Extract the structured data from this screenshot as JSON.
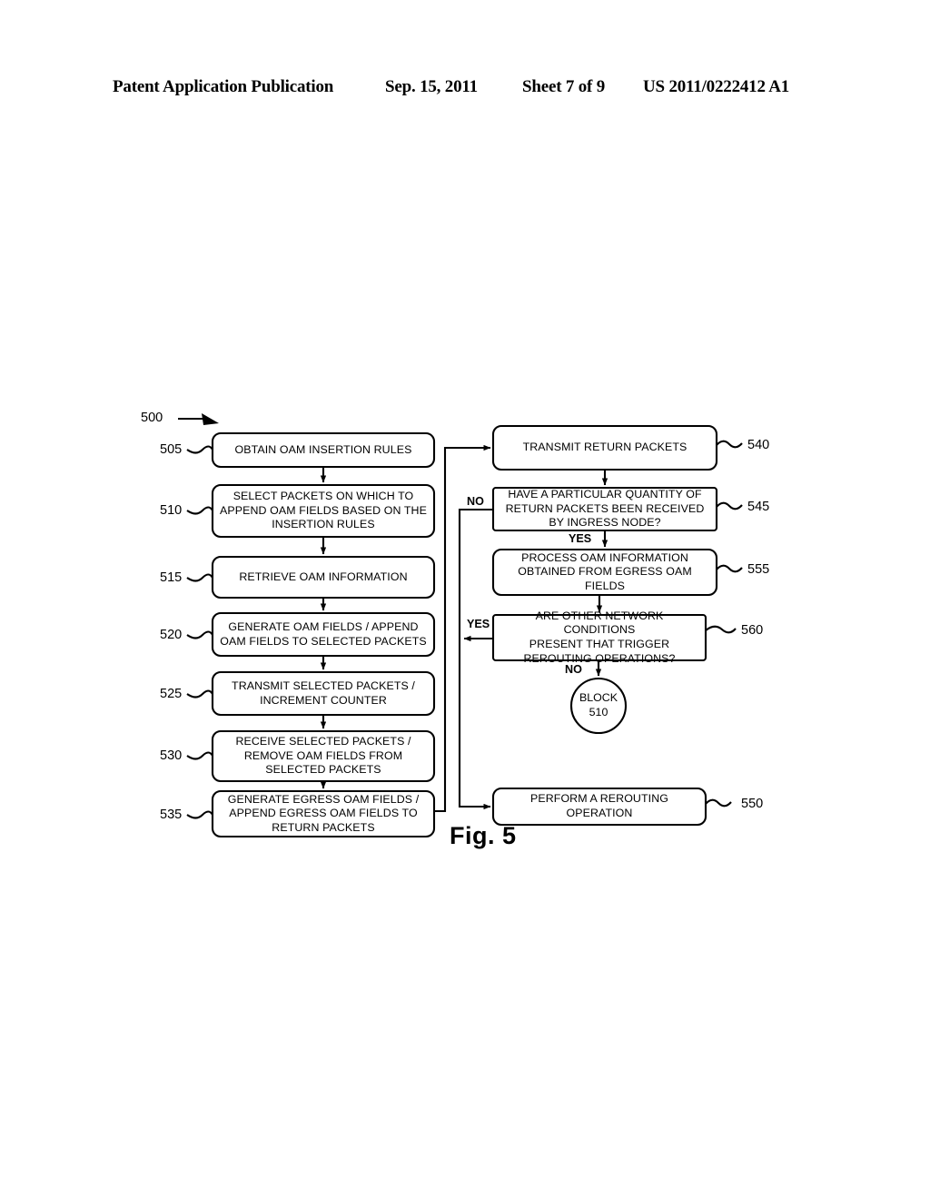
{
  "header": {
    "publication": "Patent Application Publication",
    "date": "Sep. 15, 2011",
    "sheet": "Sheet 7 of 9",
    "patent_number": "US 2011/0222412 A1"
  },
  "figure": {
    "caption": "Fig. 5",
    "diagram_ref": "500"
  },
  "nodes": [
    {
      "ref": "505",
      "text": "OBTAIN OAM INSERTION RULES"
    },
    {
      "ref": "510",
      "text": "SELECT PACKETS ON WHICH TO\nAPPEND OAM FIELDS BASED ON THE\nINSERTION RULES"
    },
    {
      "ref": "515",
      "text": "RETRIEVE OAM INFORMATION"
    },
    {
      "ref": "520",
      "text": "GENERATE OAM FIELDS / APPEND\nOAM FIELDS TO SELECTED PACKETS"
    },
    {
      "ref": "525",
      "text": "TRANSMIT SELECTED PACKETS /\nINCREMENT COUNTER"
    },
    {
      "ref": "530",
      "text": "RECEIVE SELECTED PACKETS /\nREMOVE OAM FIELDS FROM\nSELECTED PACKETS"
    },
    {
      "ref": "535",
      "text": "GENERATE EGRESS OAM FIELDS /\nAPPEND EGRESS OAM FIELDS TO\nRETURN PACKETS"
    },
    {
      "ref": "540",
      "text": "TRANSMIT RETURN PACKETS"
    },
    {
      "ref": "545",
      "text": "HAVE A PARTICULAR QUANTITY OF\nRETURN PACKETS BEEN RECEIVED\nBY INGRESS NODE?"
    },
    {
      "ref": "555",
      "text": "PROCESS OAM INFORMATION\nOBTAINED FROM EGRESS OAM\nFIELDS"
    },
    {
      "ref": "560",
      "text": "ARE OTHER NETWORK CONDITIONS\nPRESENT THAT TRIGGER\nREROUTING OPERATIONS?"
    },
    {
      "ref": "550",
      "text": "PERFORM A REROUTING\nOPERATION"
    }
  ],
  "connector_node": {
    "line1": "BLOCK",
    "line2": "510"
  },
  "edge_labels": {
    "no_545": "NO",
    "yes_545": "YES",
    "yes_560": "YES",
    "no_560": "NO"
  }
}
